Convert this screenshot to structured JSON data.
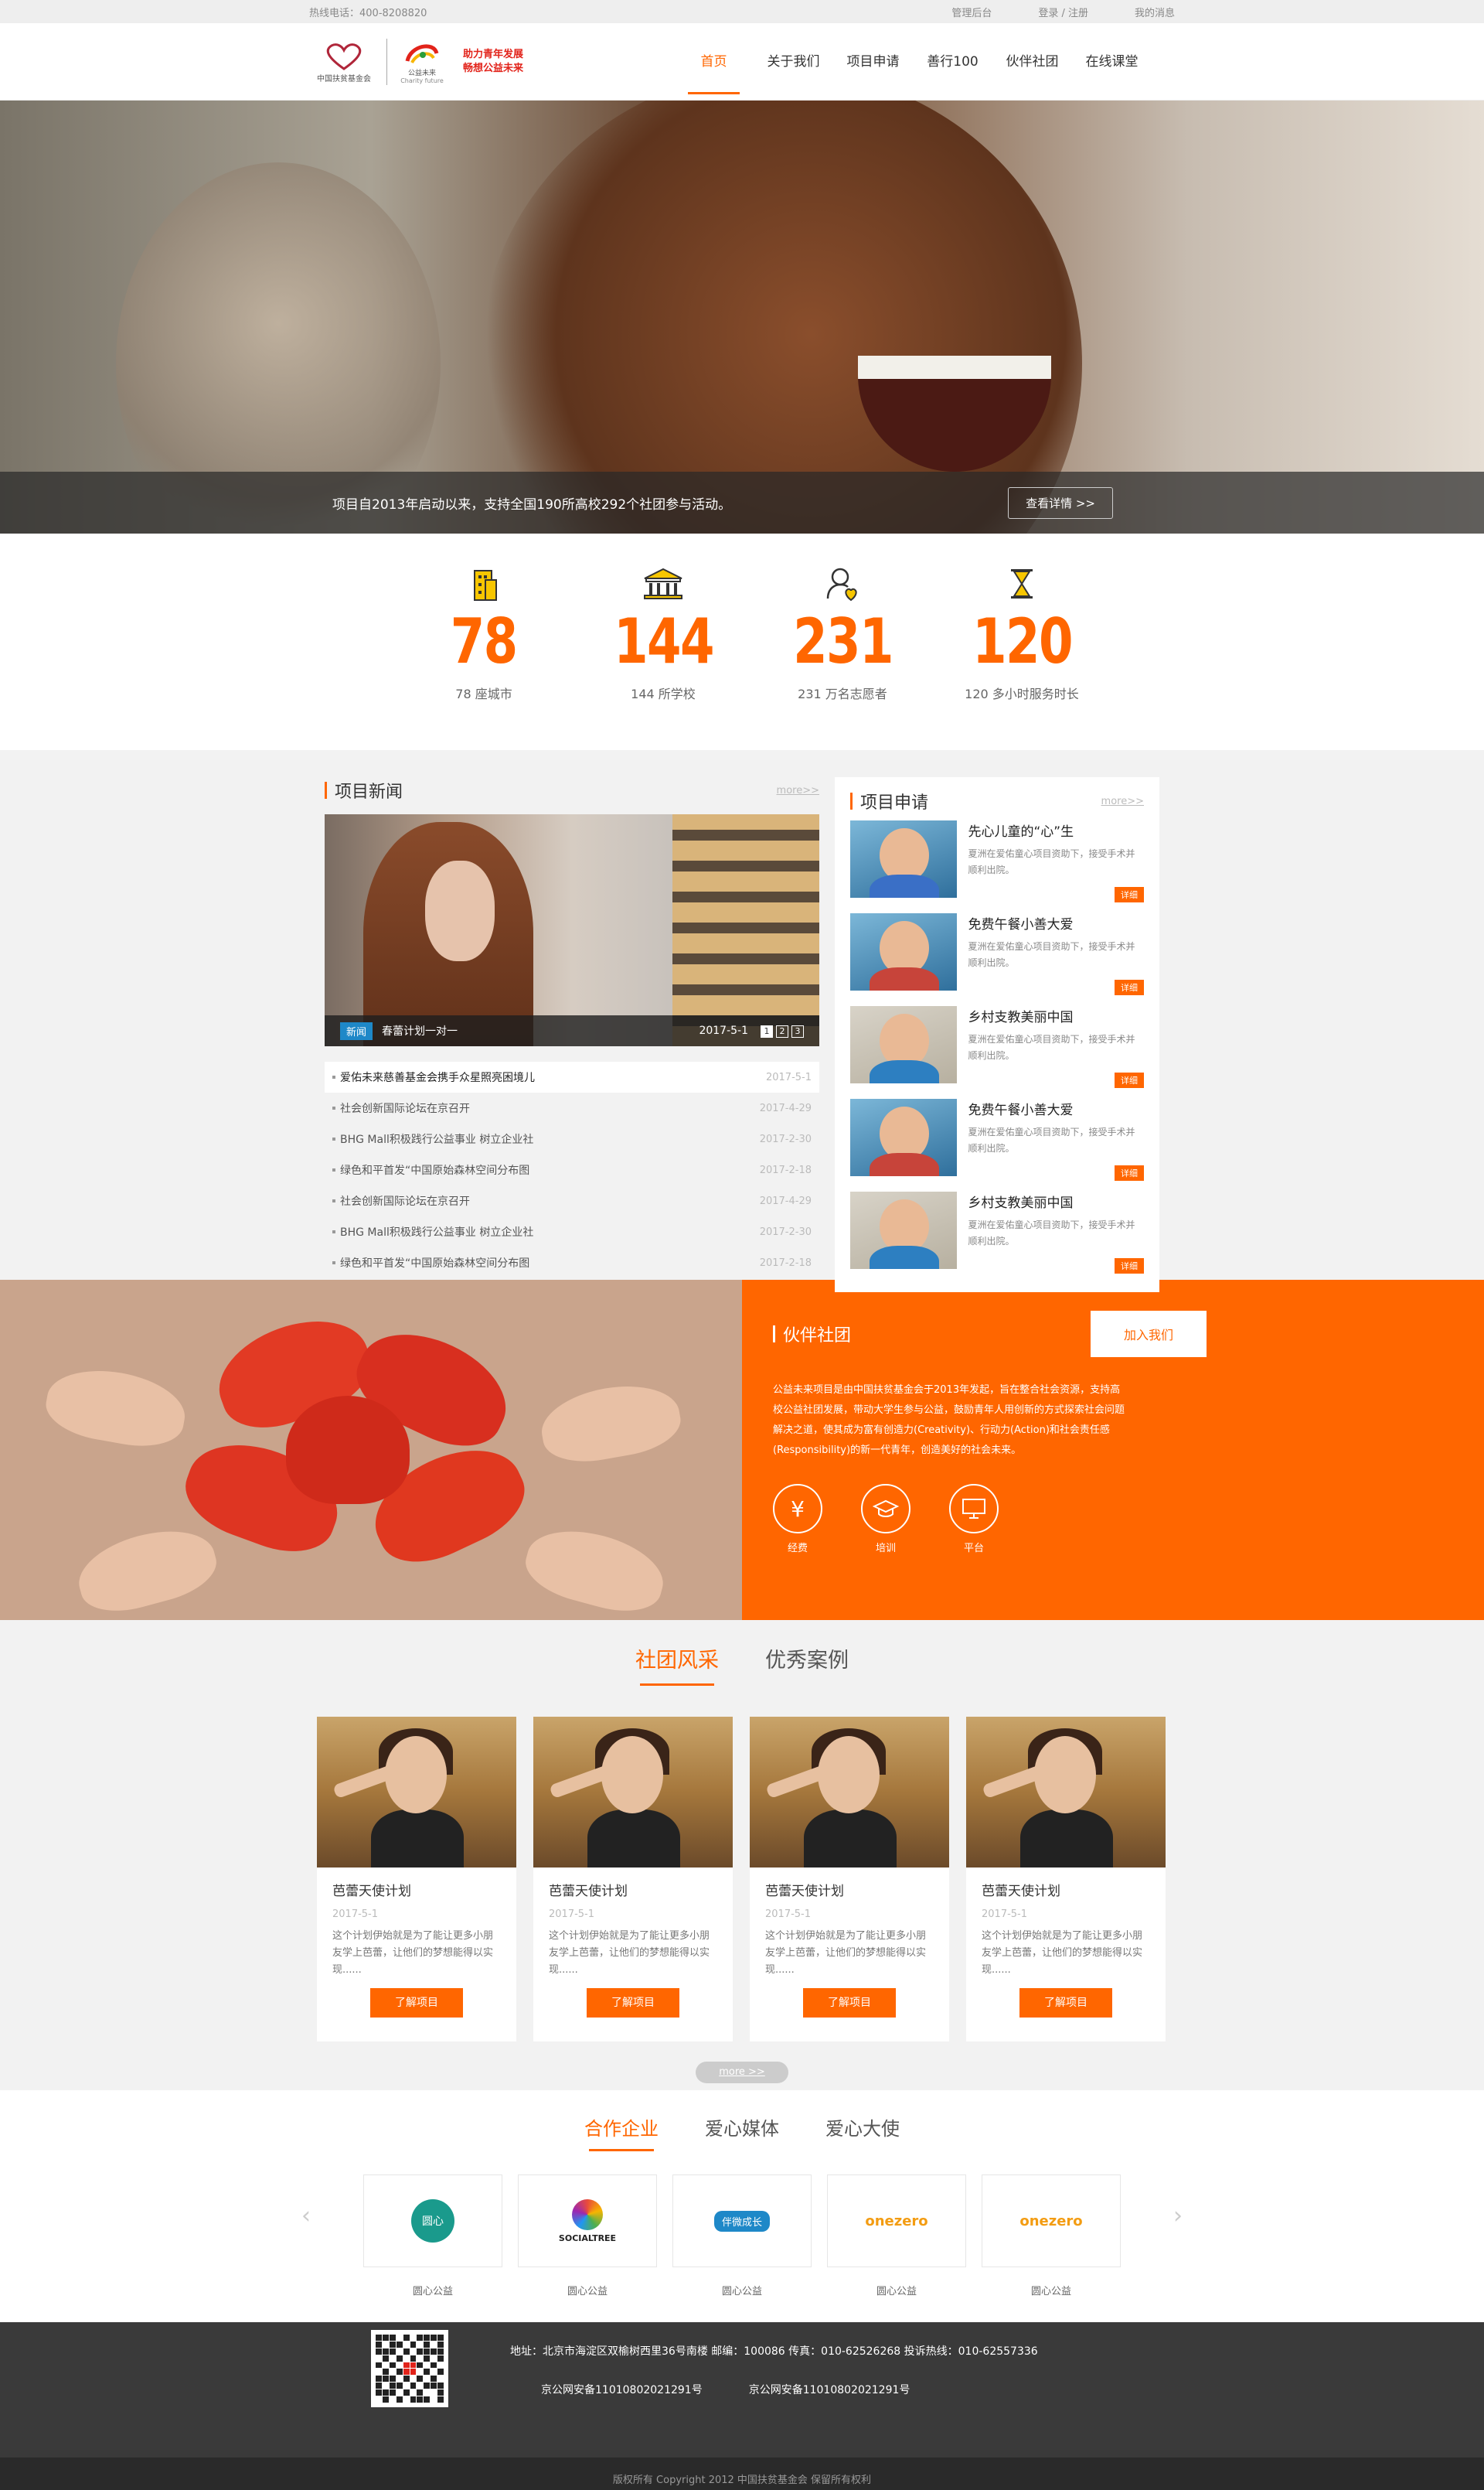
{
  "topbar": {
    "hotline": "热线电话：400-8208820",
    "admin": "管理后台",
    "login": "登录 / 注册",
    "msg": "我的消息"
  },
  "logo": {
    "org": "中国扶贫基金会",
    "brand": "公益未来",
    "brand_en": "Charity future",
    "slogan1": "助力青年发展",
    "slogan2": "畅想公益未来"
  },
  "nav": [
    "首页",
    "关于我们",
    "项目申请",
    "善行100",
    "伙伴社团",
    "在线课堂"
  ],
  "hero": {
    "caption": "项目自2013年启动以来，支持全国190所高校292个社团参与活动。",
    "button": "查看详情 >>"
  },
  "stats": [
    {
      "num": "78",
      "label": "78 座城市",
      "icon": "building-icon"
    },
    {
      "num": "144",
      "label": "144 所学校",
      "icon": "school-icon"
    },
    {
      "num": "231",
      "label": "231 万名志愿者",
      "icon": "volunteer-icon"
    },
    {
      "num": "120",
      "label": "120 多小时服务时长",
      "icon": "hourglass-icon"
    }
  ],
  "news": {
    "title": "项目新闻",
    "more": "more>>",
    "tag": "新闻",
    "headline": "春蕾计划一对一",
    "date": "2017-5-1",
    "pages": [
      "1",
      "2",
      "3"
    ],
    "items": [
      {
        "t": "爱佑未来慈善基金会携手众星照亮困境儿",
        "d": "2017-5-1"
      },
      {
        "t": "社会创新国际论坛在京召开",
        "d": "2017-4-29"
      },
      {
        "t": "BHG Mall积极践行公益事业 树立企业社",
        "d": "2017-2-30"
      },
      {
        "t": "绿色和平首发“中国原始森林空间分布图",
        "d": "2017-2-18"
      },
      {
        "t": "社会创新国际论坛在京召开",
        "d": "2017-4-29"
      },
      {
        "t": "BHG Mall积极践行公益事业 树立企业社",
        "d": "2017-2-30"
      },
      {
        "t": "绿色和平首发“中国原始森林空间分布图",
        "d": "2017-2-18"
      }
    ]
  },
  "apply": {
    "title": "项目申请",
    "more": "more>>",
    "detail": "详细",
    "items": [
      {
        "h": "先心儿童的“心”生",
        "p": "夏洲在爱佑童心项目资助下，接受手术并顺利出院。"
      },
      {
        "h": "免费午餐小善大爱",
        "p": "夏洲在爱佑童心项目资助下，接受手术并顺利出院。"
      },
      {
        "h": "乡村支教美丽中国",
        "p": "夏洲在爱佑童心项目资助下，接受手术并顺利出院。"
      },
      {
        "h": "免费午餐小善大爱",
        "p": "夏洲在爱佑童心项目资助下，接受手术并顺利出院。"
      },
      {
        "h": "乡村支教美丽中国",
        "p": "夏洲在爱佑童心项目资助下，接受手术并顺利出院。"
      }
    ]
  },
  "partner": {
    "title": "伙伴社团",
    "join": "加入我们",
    "desc": "公益未来项目是由中国扶贫基金会于2013年发起，旨在整合社会资源，支持高校公益社团发展，带动大学生参与公益，鼓励青年人用创新的方式探索社会问题解决之道，使其成为富有创造力(Creativity)、行动力(Action)和社会责任感(Responsibility)的新一代青年，创造美好的社会未来。",
    "icons": [
      {
        "label": "经费",
        "icon": "yen-icon"
      },
      {
        "label": "培训",
        "icon": "graduation-cap-icon"
      },
      {
        "label": "平台",
        "icon": "monitor-icon"
      }
    ]
  },
  "clubs": {
    "tabs": [
      "社团风采",
      "优秀案例"
    ],
    "button": "了解项目",
    "more": "more >>",
    "cards": [
      {
        "h": "芭蕾天使计划",
        "d": "2017-5-1",
        "p": "这个计划伊始就是为了能让更多小朋友学上芭蕾，让他们的梦想能得以实现......"
      },
      {
        "h": "芭蕾天使计划",
        "d": "2017-5-1",
        "p": "这个计划伊始就是为了能让更多小朋友学上芭蕾，让他们的梦想能得以实现......"
      },
      {
        "h": "芭蕾天使计划",
        "d": "2017-5-1",
        "p": "这个计划伊始就是为了能让更多小朋友学上芭蕾，让他们的梦想能得以实现......"
      },
      {
        "h": "芭蕾天使计划",
        "d": "2017-5-1",
        "p": "这个计划伊始就是为了能让更多小朋友学上芭蕾，让他们的梦想能得以实现......"
      }
    ]
  },
  "coop": {
    "tabs": [
      "合作企业",
      "爱心媒体",
      "爱心大使"
    ],
    "logos": [
      {
        "mark": "圆心",
        "name": "圆心公益"
      },
      {
        "mark": "SOCIALTREE",
        "name": "圆心公益"
      },
      {
        "mark": "伴微成长",
        "name": "圆心公益"
      },
      {
        "mark": "onezero",
        "name": "圆心公益"
      },
      {
        "mark": "onezero",
        "name": "圆心公益"
      }
    ]
  },
  "footer": {
    "address": "地址：北京市海淀区双榆树西里36号南楼 邮编：100086 传真：010-62526268 投诉热线：010-62557336",
    "icp1": "京公网安备11010802021291号",
    "icp2": "京公网安备11010802021291号",
    "copy": "版权所有 Copyright 2012 中国扶贫基金会 保留所有权利"
  },
  "colors": {
    "accent": "#ff6600",
    "footer": "#3a3a3a"
  }
}
